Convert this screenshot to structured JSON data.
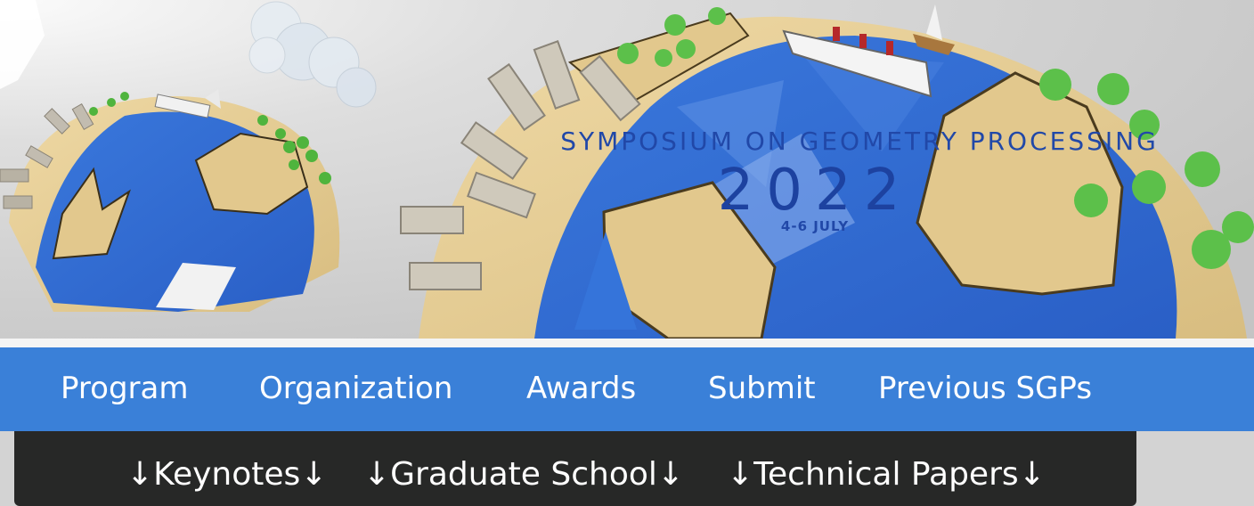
{
  "banner": {
    "title": "SYMPOSIUM ON GEOMETRY PROCESSING",
    "year": "2022",
    "dates": "4-6 JULY"
  },
  "nav": {
    "items": [
      {
        "label": "Program"
      },
      {
        "label": "Organization"
      },
      {
        "label": "Awards"
      },
      {
        "label": "Submit"
      },
      {
        "label": "Previous SGPs"
      }
    ]
  },
  "subnav": {
    "items": [
      {
        "label": "↓Keynotes↓"
      },
      {
        "label": "↓Graduate School↓"
      },
      {
        "label": "↓Technical Papers↓"
      }
    ]
  },
  "colors": {
    "nav_bg": "#3a80d8",
    "subnav_bg": "#272827",
    "title_blue": "#2148a8",
    "ocean_blue": "#2f6fd6",
    "sand": "#e3cb92"
  }
}
